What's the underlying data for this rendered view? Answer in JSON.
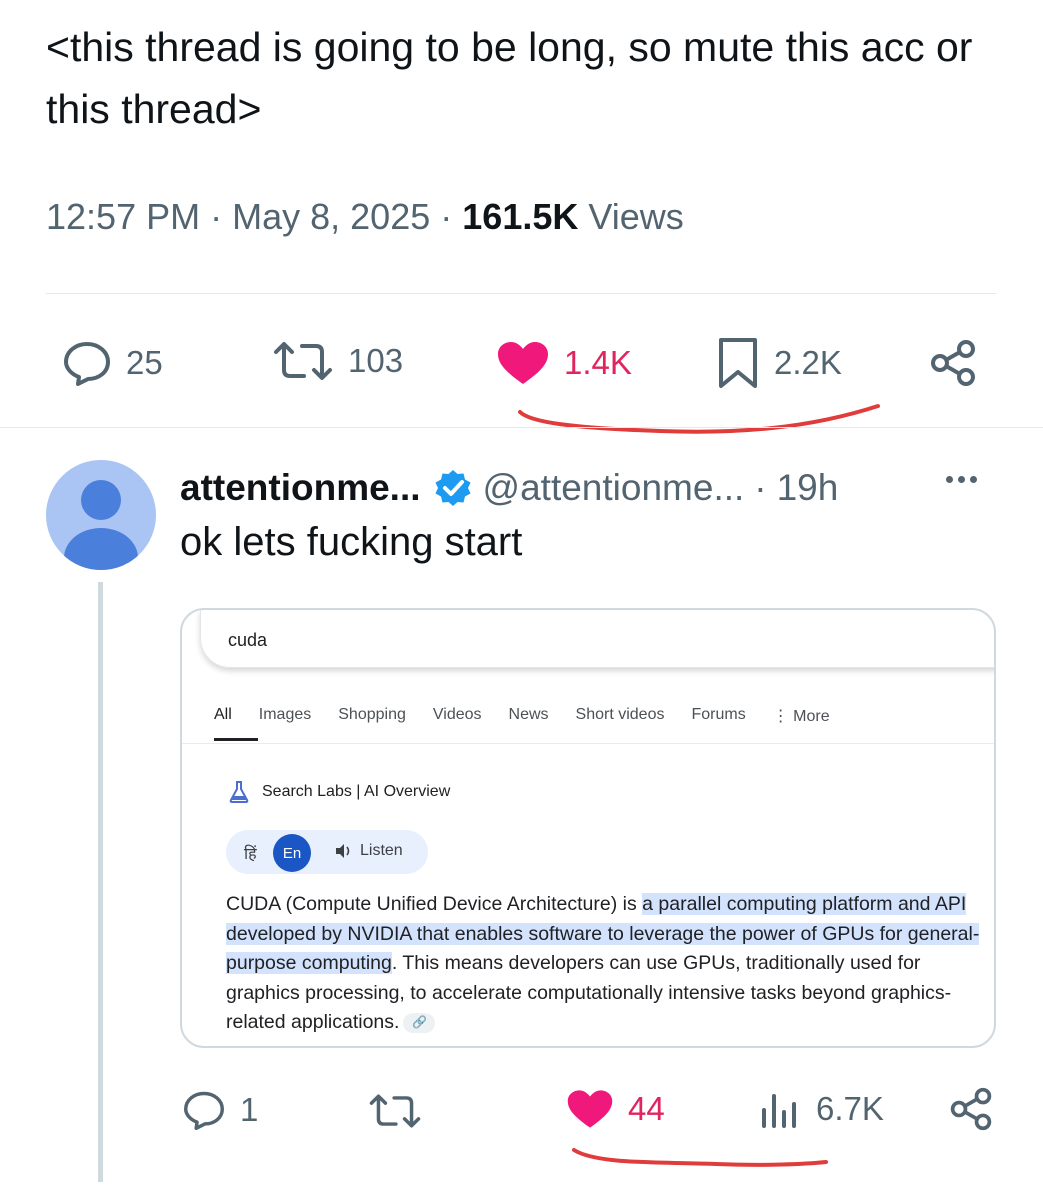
{
  "main_tweet": {
    "text": "<this thread is going to be long, so mute this acc or this thread>",
    "time": "12:57 PM",
    "separator": "·",
    "date": "May 8, 2025",
    "views_count": "161.5K",
    "views_label": "Views",
    "actions": {
      "replies": "25",
      "retweets": "103",
      "likes": "1.4K",
      "bookmarks": "2.2K"
    }
  },
  "reply": {
    "name": "attentionme...",
    "handle": "@attentionme...",
    "separator": "·",
    "time": "19h",
    "text": "ok lets fucking start",
    "actions": {
      "replies": "1",
      "likes": "44",
      "views": "6.7K"
    }
  },
  "google_card": {
    "query": "cuda",
    "tabs": [
      "All",
      "Images",
      "Shopping",
      "Videos",
      "News",
      "Short videos",
      "Forums",
      "⋮ More"
    ],
    "active_tab": "All",
    "ai_label": "Search Labs | AI Overview",
    "lang_hindi": "हिं",
    "lang_english": "En",
    "listen_label": "Listen",
    "answer": {
      "lead": "CUDA (Compute Unified Device Architecture) is ",
      "highlight": "a parallel computing platform and API developed by NVIDIA that enables software to leverage the power of GPUs for general-purpose computing",
      "rest": ". This means developers can use GPUs, traditionally used for graphics processing, to accelerate computationally intensive tasks beyond graphics-related applications."
    }
  },
  "colors": {
    "text_primary": "#0f1419",
    "text_secondary": "#536471",
    "like_pink": "#e0245e",
    "verified_blue": "#1d9bf0",
    "annotation_red": "#e03c3c",
    "highlight_blue": "#d3e3fd"
  },
  "icons": [
    "reply-icon",
    "retweet-icon",
    "heart-icon",
    "bookmark-icon",
    "share-icon",
    "verified-badge-icon",
    "more-icon",
    "views-icon",
    "flask-icon",
    "speaker-icon",
    "link-icon"
  ]
}
